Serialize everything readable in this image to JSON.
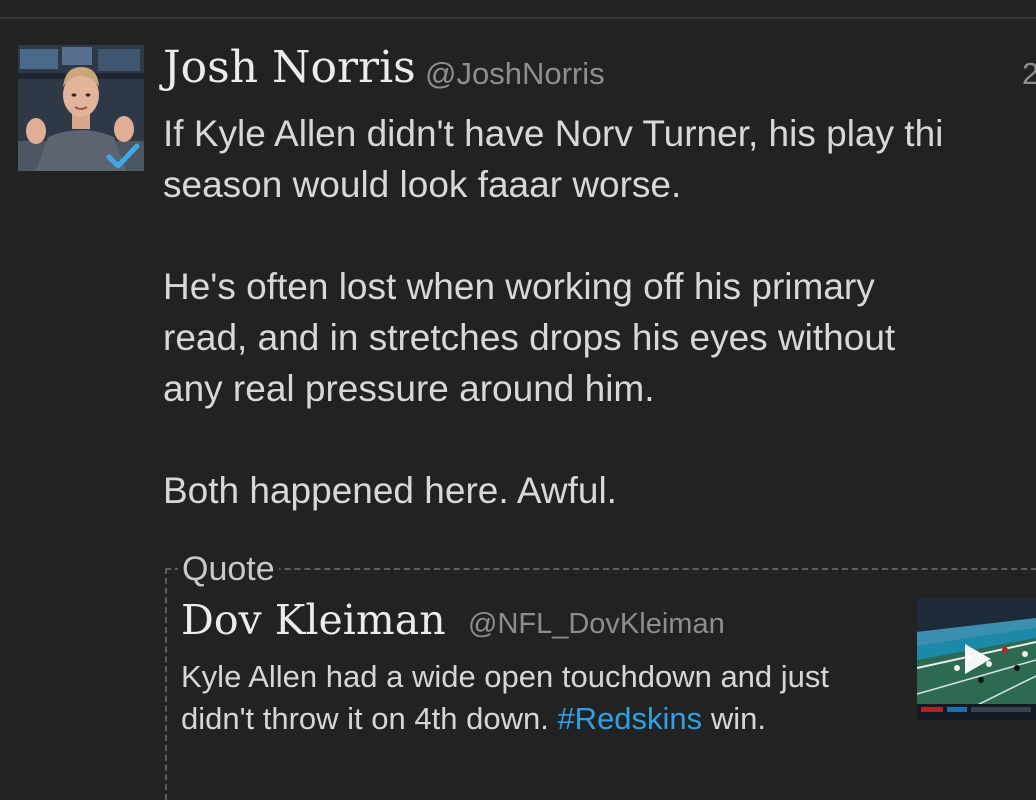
{
  "tweet": {
    "author_name": "Josh Norris",
    "author_handle": "@JoshNorris",
    "timestamp": "2",
    "verified": true,
    "lines": [
      "If Kyle Allen didn't have Norv Turner, his play thi",
      "season would look faaar worse.",
      "",
      "He's often lost when working off his primary",
      "read, and in stretches drops his eyes without",
      "any real pressure around him.",
      "",
      "Both happened here. Awful."
    ]
  },
  "quote": {
    "label": "Quote",
    "author_name": "Dov Kleiman",
    "author_handle": "@NFL_DovKleiman",
    "line1": "Kyle Allen had a wide open touchdown and just",
    "line2_before": "didn't throw it on 4th down.",
    "hashtag": "#Redskins",
    "line2_after": "win.",
    "media_icon": "play-icon"
  },
  "colors": {
    "background": "#222222",
    "hashtag": "#2ea0e6",
    "verified": "#3fa9e8"
  }
}
